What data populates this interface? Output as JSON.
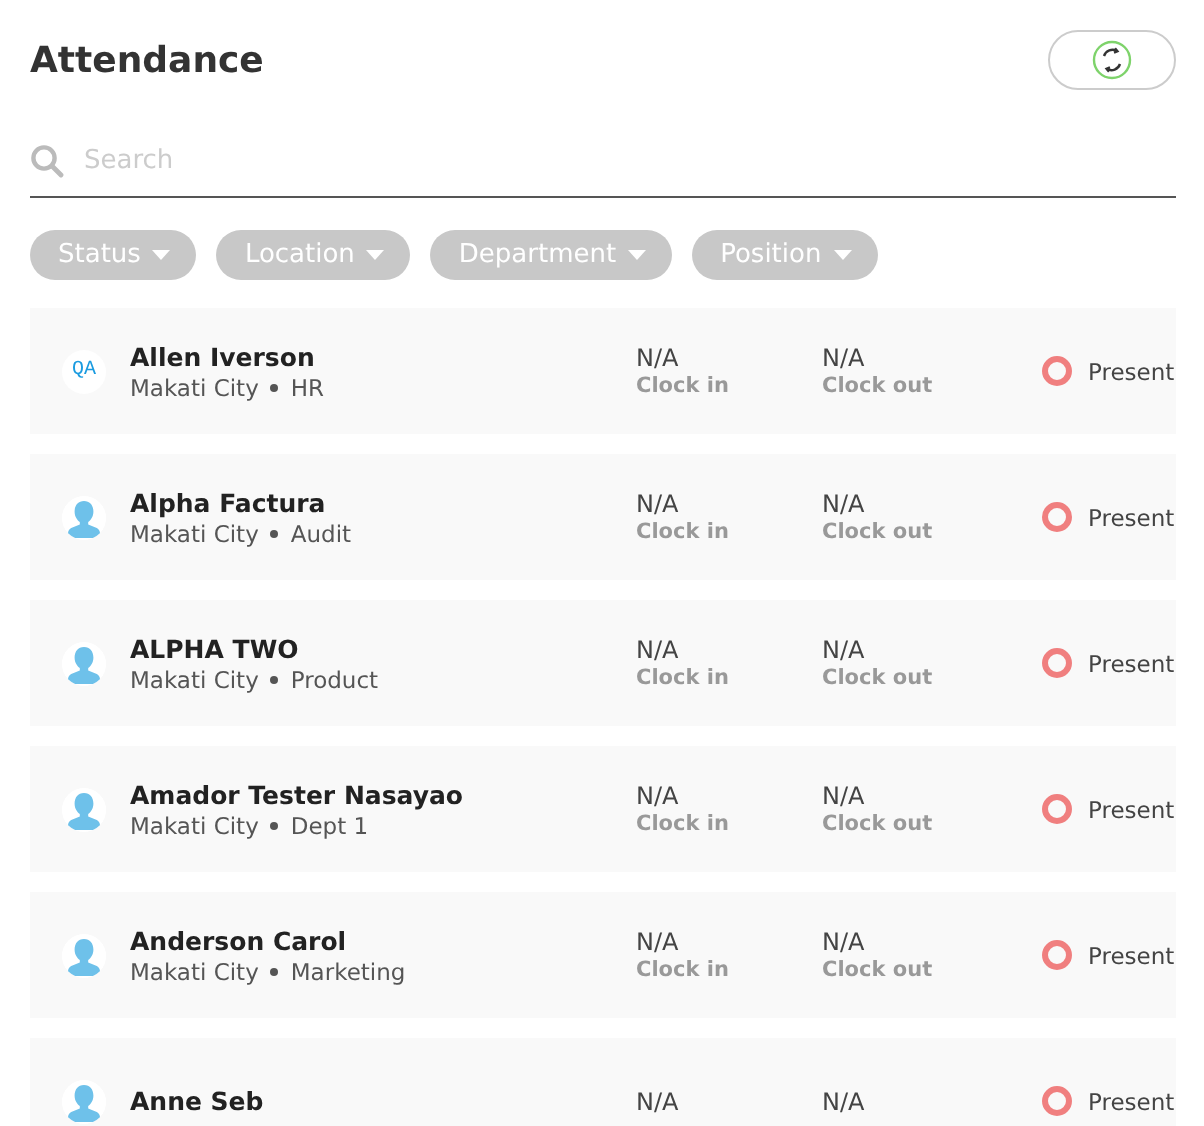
{
  "header": {
    "title": "Attendance"
  },
  "search": {
    "placeholder": "Search"
  },
  "filters": [
    {
      "label": "Status"
    },
    {
      "label": "Location"
    },
    {
      "label": "Department"
    },
    {
      "label": "Position"
    }
  ],
  "employees": [
    {
      "name": "Allen Iverson",
      "location": "Makati City",
      "department": "HR",
      "avatar": {
        "kind": "initials",
        "text": "QA"
      },
      "clock_in": {
        "time": "N/A",
        "label": "Clock in"
      },
      "clock_out": {
        "time": "N/A",
        "label": "Clock out"
      },
      "status": {
        "label": "Present",
        "color": "#f07f7f"
      }
    },
    {
      "name": "Alpha Factura",
      "location": "Makati City",
      "department": "Audit",
      "avatar": {
        "kind": "silhouette"
      },
      "clock_in": {
        "time": "N/A",
        "label": "Clock in"
      },
      "clock_out": {
        "time": "N/A",
        "label": "Clock out"
      },
      "status": {
        "label": "Present",
        "color": "#f07f7f"
      }
    },
    {
      "name": "ALPHA TWO",
      "location": "Makati City",
      "department": "Product",
      "avatar": {
        "kind": "silhouette"
      },
      "clock_in": {
        "time": "N/A",
        "label": "Clock in"
      },
      "clock_out": {
        "time": "N/A",
        "label": "Clock out"
      },
      "status": {
        "label": "Present",
        "color": "#f07f7f"
      }
    },
    {
      "name": "Amador Tester Nasayao",
      "location": "Makati City",
      "department": "Dept 1",
      "avatar": {
        "kind": "silhouette"
      },
      "clock_in": {
        "time": "N/A",
        "label": "Clock in"
      },
      "clock_out": {
        "time": "N/A",
        "label": "Clock out"
      },
      "status": {
        "label": "Present",
        "color": "#f07f7f"
      }
    },
    {
      "name": "Anderson Carol",
      "location": "Makati City",
      "department": "Marketing",
      "avatar": {
        "kind": "silhouette"
      },
      "clock_in": {
        "time": "N/A",
        "label": "Clock in"
      },
      "clock_out": {
        "time": "N/A",
        "label": "Clock out"
      },
      "status": {
        "label": "Present",
        "color": "#f07f7f"
      }
    },
    {
      "name": "Anne Seb",
      "avatar": {
        "kind": "silhouette"
      },
      "clock_in": {
        "time": "N/A"
      },
      "clock_out": {
        "time": "N/A"
      },
      "status": {
        "label": "Present",
        "color": "#f07f7f"
      }
    }
  ]
}
